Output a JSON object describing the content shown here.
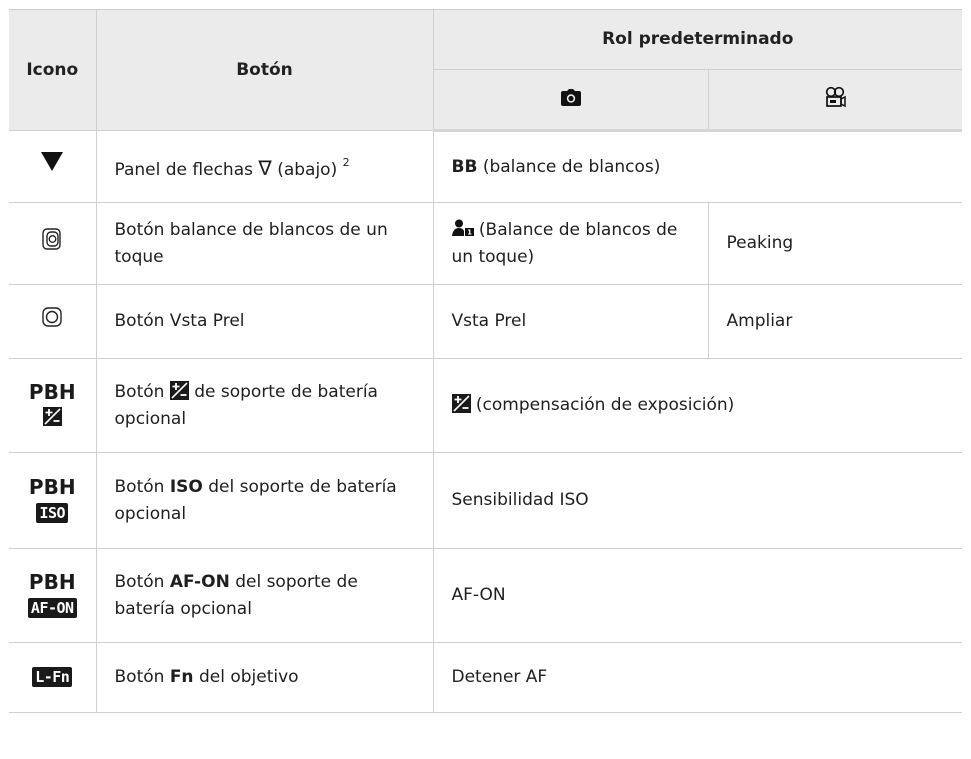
{
  "header": {
    "icon": "Icono",
    "button": "Botón",
    "default_role": "Rol predeterminado",
    "photo_icon": "camera-icon",
    "movie_icon": "movie-camera-icon"
  },
  "rows": [
    {
      "icon_name": "down-triangle-icon",
      "button_text": "Panel de flechas",
      "button_sym": "∇",
      "button_text2": "(abajo)",
      "button_sup": "2",
      "role_bold": "BB",
      "role_text": "(balance de blancos)"
    },
    {
      "icon_name": "one-touch-wb-button-icon",
      "button_text": "Botón balance de blancos de un toque",
      "photo_role": "(Balance de blancos de un toque)",
      "photo_icon_name": "one-touch-wb-icon",
      "movie_role": "Peaking"
    },
    {
      "icon_name": "preview-button-icon",
      "button_text": "Botón Vsta Prel",
      "photo_role": "Vsta Prel",
      "movie_role": "Ampliar"
    },
    {
      "pbh": "PBH",
      "icon_name": "exposure-compensation-icon",
      "button_pre": "Botón",
      "button_post": "de soporte de batería opcional",
      "role_text": "(compensación de exposición)"
    },
    {
      "pbh": "PBH",
      "badge": "ISO",
      "button_pre": "Botón",
      "button_bold": "ISO",
      "button_post": "del soporte de batería opcional",
      "role_text": "Sensibilidad ISO"
    },
    {
      "pbh": "PBH",
      "badge": "AF-ON",
      "button_pre": "Botón",
      "button_bold": "AF-ON",
      "button_post": "del soporte de batería opcional",
      "role_text": "AF-ON"
    },
    {
      "badge": "L-Fn",
      "button_pre": "Botón",
      "button_bold": "Fn",
      "button_post": "del objetivo",
      "role_text": "Detener AF"
    }
  ]
}
